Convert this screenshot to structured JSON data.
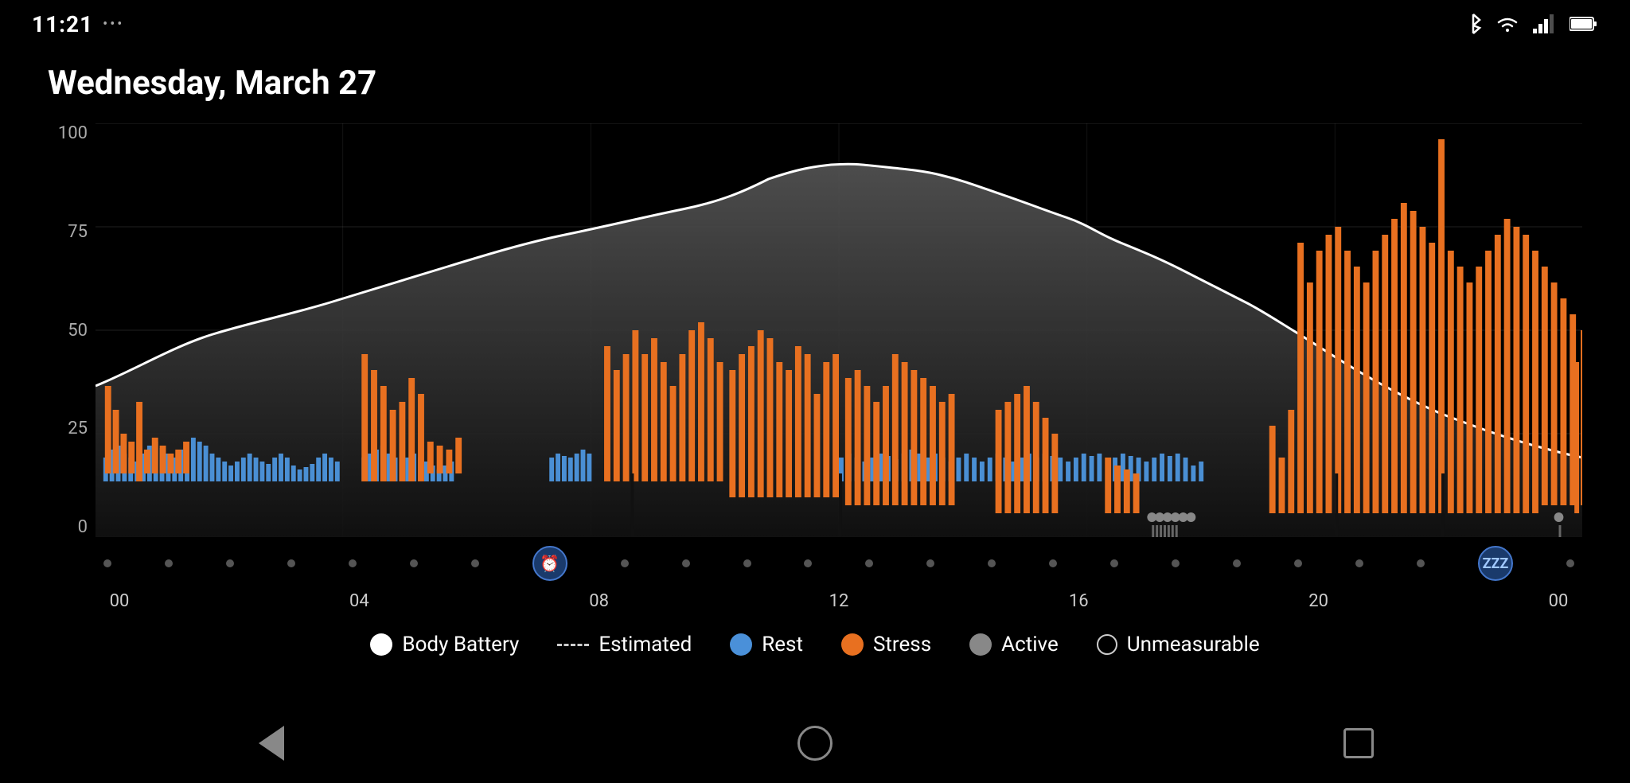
{
  "status_bar": {
    "time": "11:21",
    "dots": "•••",
    "icons": [
      "bluetooth",
      "wifi",
      "signal",
      "battery"
    ]
  },
  "page": {
    "title": "Wednesday, March 27"
  },
  "chart": {
    "y_labels": [
      "100",
      "75",
      "50",
      "25",
      "0"
    ],
    "x_labels": [
      "00",
      "04",
      "08",
      "12",
      "16",
      "20",
      "00"
    ]
  },
  "legend": {
    "items": [
      {
        "key": "body_battery",
        "type": "dot-white",
        "label": "Body Battery"
      },
      {
        "key": "estimated",
        "type": "dashed",
        "label": "Estimated"
      },
      {
        "key": "rest",
        "type": "dot-blue",
        "label": "Rest"
      },
      {
        "key": "stress",
        "type": "dot-orange",
        "label": "Stress"
      },
      {
        "key": "active",
        "type": "dot-gray",
        "label": "Active"
      },
      {
        "key": "unmeasurable",
        "type": "dot-outline",
        "label": "Unmeasurable"
      }
    ]
  },
  "nav": {
    "back": "back",
    "home": "home",
    "recent": "recent"
  }
}
